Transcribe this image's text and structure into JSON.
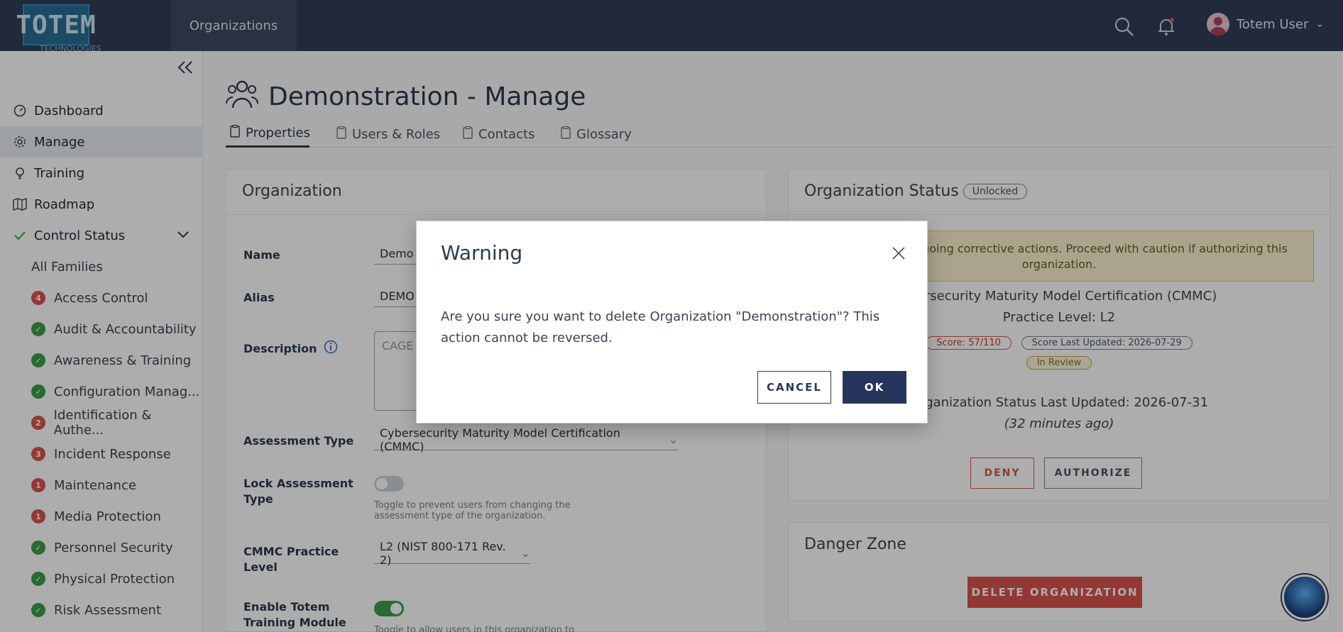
{
  "app": {
    "logo_text": "TOTEM",
    "logo_subtext": "TECHNOLOGIES",
    "nav_tab": "Organizations",
    "user_name": "Totem User"
  },
  "sidebar": {
    "items": [
      {
        "label": "Dashboard",
        "icon": "gauge-icon"
      },
      {
        "label": "Manage",
        "icon": "gear-icon"
      },
      {
        "label": "Training",
        "icon": "lightbulb-icon"
      },
      {
        "label": "Roadmap",
        "icon": "map-icon"
      },
      {
        "label": "Control Status",
        "icon": "check-icon"
      }
    ],
    "families": [
      {
        "label": "All Families",
        "badge": "",
        "status": "none"
      },
      {
        "label": "Access Control",
        "badge": "4",
        "status": "red"
      },
      {
        "label": "Audit & Accountability",
        "badge": "✓",
        "status": "green"
      },
      {
        "label": "Awareness & Training",
        "badge": "✓",
        "status": "green"
      },
      {
        "label": "Configuration Manag...",
        "badge": "✓",
        "status": "green"
      },
      {
        "label": "Identification & Authe...",
        "badge": "2",
        "status": "red"
      },
      {
        "label": "Incident Response",
        "badge": "3",
        "status": "red"
      },
      {
        "label": "Maintenance",
        "badge": "1",
        "status": "red"
      },
      {
        "label": "Media Protection",
        "badge": "1",
        "status": "red"
      },
      {
        "label": "Personnel Security",
        "badge": "✓",
        "status": "green"
      },
      {
        "label": "Physical Protection",
        "badge": "✓",
        "status": "green"
      },
      {
        "label": "Risk Assessment",
        "badge": "✓",
        "status": "green"
      }
    ]
  },
  "page": {
    "title": "Demonstration - Manage",
    "tabs": [
      "Properties",
      "Users & Roles",
      "Contacts",
      "Glossary"
    ]
  },
  "org_card": {
    "title": "Organization",
    "name_label": "Name",
    "name_value": "Demo",
    "alias_label": "Alias",
    "alias_value": "DEMO",
    "description_label": "Description",
    "description_value": "CAGE",
    "assessment_label": "Assessment Type",
    "assessment_value": "Cybersecurity Maturity Model Certification (CMMC)",
    "lock_label": "Lock Assessment Type",
    "lock_hint": "Toggle to prevent users from changing the assessment type of the organization.",
    "practice_label": "CMMC Practice Level",
    "practice_value": "L2 (NIST 800-171 Rev. 2)",
    "training_label": "Enable Totem Training Module",
    "training_hint": "Toggle to allow users in this organization to access"
  },
  "status_card": {
    "title": "Organization Status",
    "badge": "Unlocked",
    "warning": "M consists of ongoing corrective actions. Proceed with caution if authorizing this organization.",
    "model": "ybersecurity Maturity Model Certification (CMMC)",
    "practice": "Practice Level: L2",
    "score": "Score: 57/110",
    "score_updated": "Score Last Updated: 2026-07-29",
    "review": "In Review",
    "status_updated": "Organization Status Last Updated: 2026-07-31",
    "ago": "(32 minutes ago)",
    "deny": "DENY",
    "authorize": "AUTHORIZE"
  },
  "danger_card": {
    "title": "Danger Zone",
    "delete": "DELETE ORGANIZATION"
  },
  "modal": {
    "title": "Warning",
    "body": "Are you sure you want to delete Organization \"Demonstration\"? This action cannot be reversed.",
    "cancel": "CANCEL",
    "ok": "OK"
  },
  "colors": {
    "topbar": "#313f56",
    "primary": "#26355c",
    "danger": "#d9534f",
    "success": "#3b9d4a"
  }
}
